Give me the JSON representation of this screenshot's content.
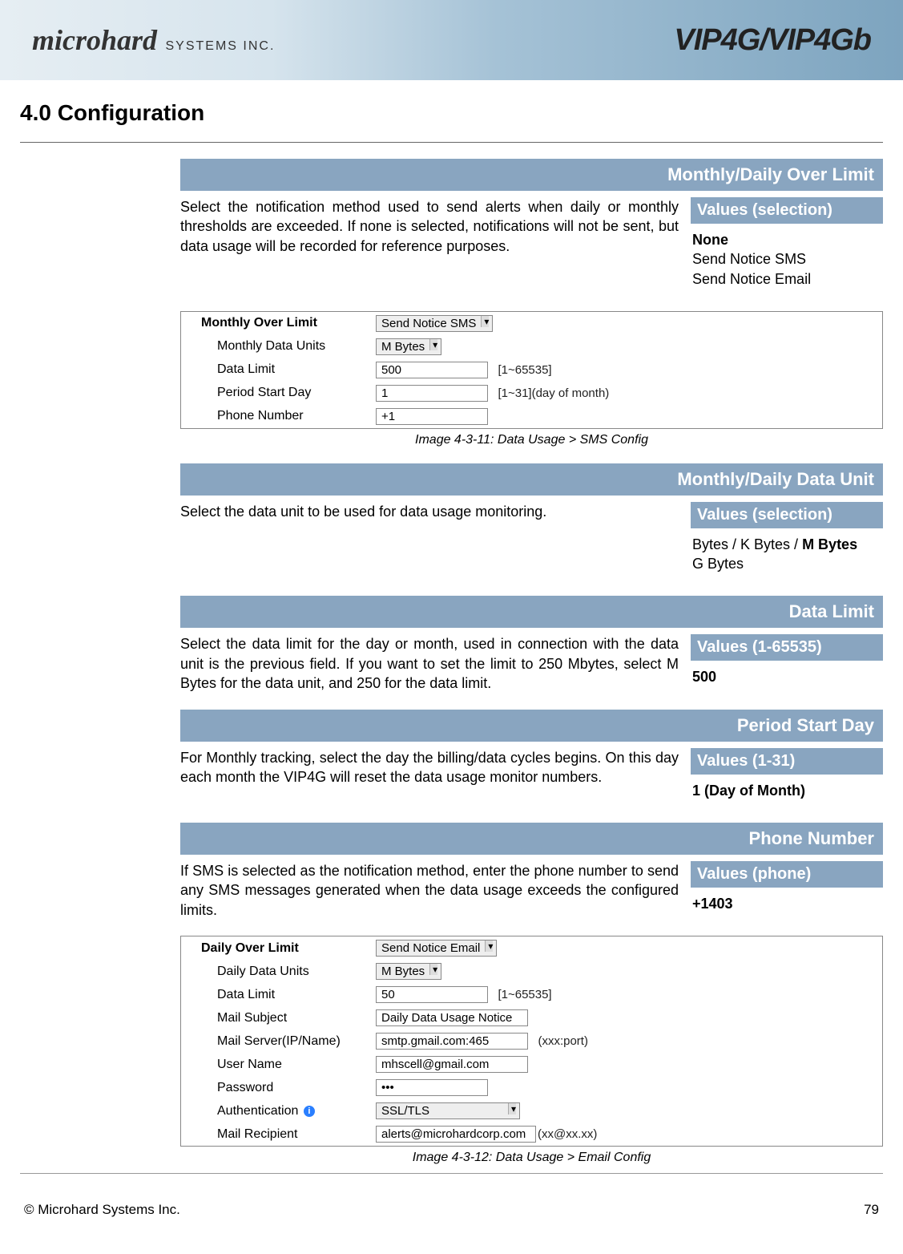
{
  "header": {
    "brand_left_main": "microhard",
    "brand_left_sub": " SYSTEMS INC.",
    "brand_right": "VIP4G/VIP4Gb"
  },
  "section_title": "4.0  Configuration",
  "params": {
    "over_limit": {
      "title": "Monthly/Daily Over Limit",
      "desc": "Select the notification method used to send alerts when daily or monthly thresholds are exceeded. If none is selected, notifications will not be sent, but data usage will be recorded for reference purposes.",
      "values_header": "Values (selection)",
      "opt_none": "None",
      "opt_sms": "Send Notice SMS",
      "opt_email": "Send Notice Email"
    },
    "data_unit": {
      "title": "Monthly/Daily Data Unit",
      "desc": "Select the data unit to be used for data usage monitoring.",
      "values_header": "Values (selection)",
      "line1_a": "Bytes / K Bytes / ",
      "line1_b": "M Bytes",
      "line2": "G Bytes"
    },
    "data_limit": {
      "title": "Data Limit",
      "desc": "Select the data limit for the day or month, used in connection with the data unit is the previous field. If you want to set the limit to 250 Mbytes, select M Bytes for the data unit, and 250 for the data limit.",
      "values_header": "Values (1-65535)",
      "value": "500"
    },
    "period_start": {
      "title": "Period Start Day",
      "desc": "For Monthly tracking, select the day the billing/data cycles begins. On this day each month the VIP4G will reset the data usage monitor numbers.",
      "values_header": "Values (1-31)",
      "value": "1 (Day of Month)"
    },
    "phone_number": {
      "title": "Phone Number",
      "desc": "If SMS is selected as the notification method, enter the phone number to send any SMS messages generated when the data usage exceeds the configured limits.",
      "values_header": "Values (phone)",
      "value": "+1403"
    }
  },
  "fig_sms": {
    "caption": "Image 4-3-11:  Data Usage > SMS Config",
    "rows": {
      "monthly_over_limit_label": "Monthly Over Limit",
      "monthly_over_limit_value": "Send Notice SMS",
      "monthly_data_units_label": "Monthly Data Units",
      "monthly_data_units_value": "M Bytes",
      "data_limit_label": "Data Limit",
      "data_limit_value": "500",
      "data_limit_hint": "[1~65535]",
      "period_start_label": "Period Start Day",
      "period_start_value": "1",
      "period_start_hint": "[1~31](day of month)",
      "phone_label": "Phone Number",
      "phone_value": "+1"
    }
  },
  "fig_email": {
    "caption": "Image 4-3-12:  Data Usage > Email Config",
    "rows": {
      "daily_over_limit_label": "Daily Over Limit",
      "daily_over_limit_value": "Send Notice Email",
      "daily_data_units_label": "Daily Data Units",
      "daily_data_units_value": "M Bytes",
      "data_limit_label": "Data Limit",
      "data_limit_value": "50",
      "data_limit_hint": "[1~65535]",
      "mail_subject_label": "Mail Subject",
      "mail_subject_value": "Daily Data Usage Notice",
      "mail_server_label": "Mail Server(IP/Name)",
      "mail_server_value": "smtp.gmail.com:465",
      "mail_server_hint": "(xxx:port)",
      "user_name_label": "User Name",
      "user_name_value": "mhscell@gmail.com",
      "password_label": "Password",
      "password_value": "•••",
      "auth_label": "Authentication",
      "auth_value": "SSL/TLS",
      "recipient_label": "Mail Recipient",
      "recipient_value": "alerts@microhardcorp.com",
      "recipient_hint": "(xx@xx.xx)"
    }
  },
  "footer": {
    "copyright": "© Microhard Systems Inc.",
    "page_number": "79"
  }
}
